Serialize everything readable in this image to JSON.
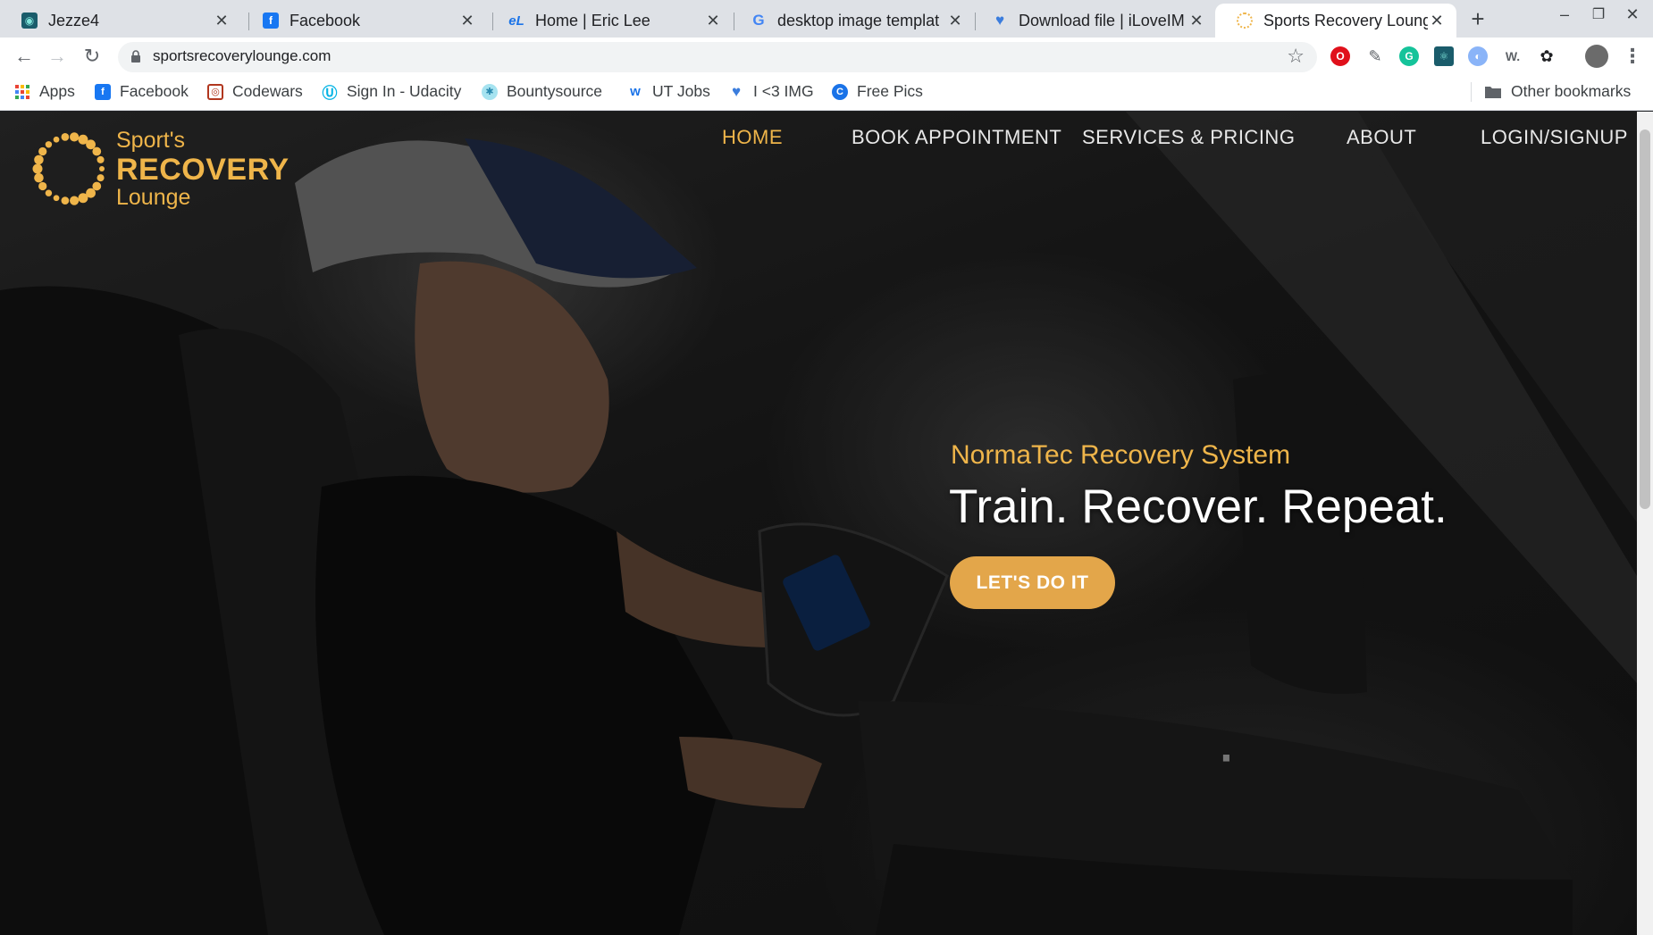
{
  "browser": {
    "tabs": [
      {
        "title": "Jezze4",
        "icon": "jezze-favicon-icon",
        "color": "#1a5c6b"
      },
      {
        "title": "Facebook",
        "icon": "facebook-favicon-icon",
        "color": "#1877f2"
      },
      {
        "title": "Home | Eric Lee",
        "icon": "el-favicon-icon",
        "color": "#1a73e8"
      },
      {
        "title": "desktop image templat",
        "icon": "google-favicon-icon",
        "color": "#4285f4"
      },
      {
        "title": "Download file | iLoveIM",
        "icon": "heart-favicon-icon",
        "color": "#3b7ddd"
      },
      {
        "title": "Sports Recovery Loung",
        "icon": "srl-favicon-icon",
        "color": "#efb54a"
      }
    ],
    "new_tab_label": "+",
    "url": "sportsrecoverylounge.com",
    "bookmarks": [
      {
        "label": "Apps",
        "icon": "apps-grid-icon"
      },
      {
        "label": "Facebook",
        "icon": "facebook-icon"
      },
      {
        "label": "Codewars",
        "icon": "codewars-icon"
      },
      {
        "label": "Sign In - Udacity",
        "icon": "udacity-icon"
      },
      {
        "label": "Bountysource",
        "icon": "bountysource-icon"
      },
      {
        "label": "UT Jobs",
        "icon": "ut-jobs-icon"
      },
      {
        "label": "I <3 IMG",
        "icon": "heart-icon"
      },
      {
        "label": "Free Pics",
        "icon": "free-pics-icon"
      }
    ],
    "other_bookmarks": "Other bookmarks"
  },
  "site": {
    "brand": {
      "line1": "Sport's",
      "line2": "RECOVERY",
      "line3": "Lounge"
    },
    "nav": {
      "home": "HOME",
      "book": "BOOK APPOINTMENT",
      "services": "SERVICES & PRICING",
      "about": "ABOUT",
      "login": "LOGIN/SIGNUP"
    },
    "hero": {
      "subtitle": "NormaTec Recovery System",
      "title": "Train. Recover. Repeat.",
      "cta": "LET'S DO IT"
    },
    "colors": {
      "accent": "#efb54a",
      "button": "#e3a64a"
    }
  }
}
